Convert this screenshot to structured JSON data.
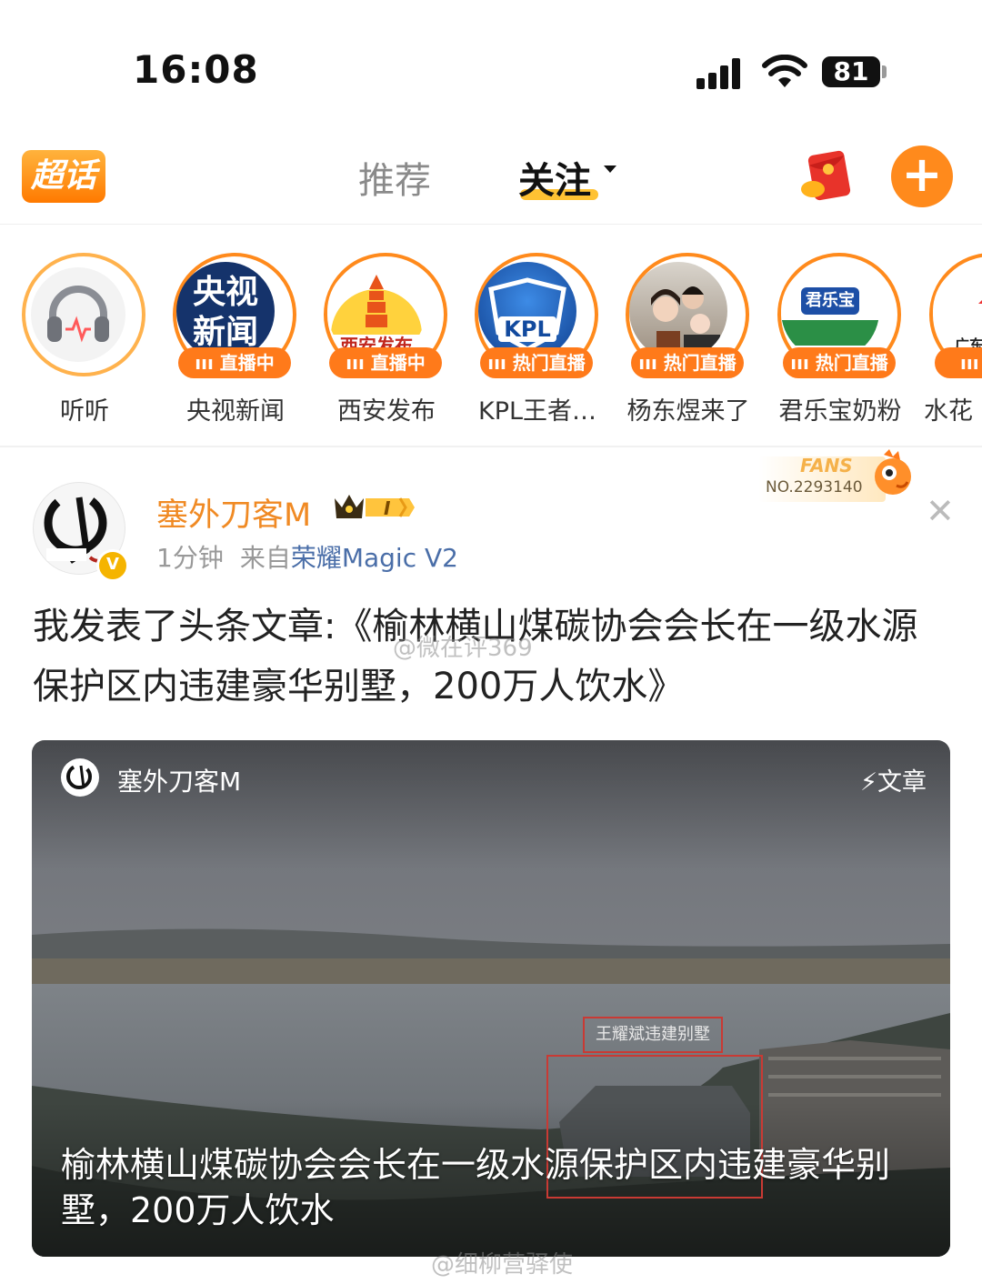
{
  "status_bar": {
    "time": "16:08",
    "battery": "81"
  },
  "nav": {
    "logo": "超话",
    "tabs": [
      "推荐",
      "关注"
    ],
    "active_tab": "关注"
  },
  "stories": [
    {
      "name": "听听",
      "badge": ""
    },
    {
      "name": "央视新闻",
      "badge": "直播中",
      "logo_text": "央视新闻"
    },
    {
      "name": "西安发布",
      "badge": "直播中",
      "logo_text": "西安发布"
    },
    {
      "name": "KPL王者…",
      "badge": "热门直播",
      "logo_text": "KPL"
    },
    {
      "name": "杨东煜来了",
      "badge": "热门直播"
    },
    {
      "name": "君乐宝奶粉",
      "badge": "热门直播",
      "logo_text": "君乐宝"
    },
    {
      "name": "水花",
      "badge": "热",
      "logo_text": "广东"
    }
  ],
  "post": {
    "author": "塞外刀客M",
    "level": "I",
    "time": "1分钟",
    "source_prefix": "来自",
    "source": "荣耀Magic V2",
    "fans_label": "FANS",
    "fans_no": "NO.2293140",
    "text": "我发表了头条文章:《榆林横山煤碳协会会长在一级水源保护区内违建豪华别墅，200万人饮水》",
    "card": {
      "author": "塞外刀客M",
      "type": "文章",
      "title": "榆林横山煤碳协会会长在一级水源保护区内违建豪华别墅，200万人饮水",
      "annotation": "王耀斌违建别墅"
    }
  },
  "watermarks": [
    "@微在评369",
    "@细柳营驿使"
  ],
  "colors": {
    "accent": "#ff8a1c",
    "author": "#f08a24",
    "annotation": "#c93a34"
  }
}
